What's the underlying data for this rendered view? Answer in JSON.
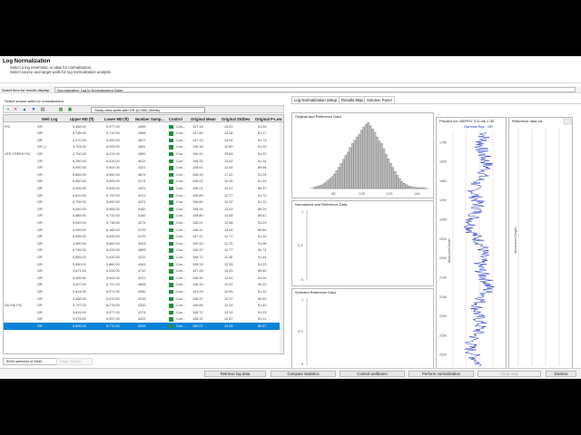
{
  "header": {
    "title": "Log Normalization",
    "line1": "Select a log mnemonic or alias for normalization.",
    "line2": "Select source and target wells for log normalization analysis"
  },
  "results_bar": {
    "label": "Select item for results display:",
    "value": "Normalization Tag to Normalization Base"
  },
  "left": {
    "caption": "Select source wells for normalization",
    "toolbar_icons": [
      "add-icon",
      "remove-icon",
      "up-arrow-icon",
      "down-arrow-icon",
      "filter-icon",
      "grid-icon",
      "zoom-icon"
    ],
    "combo_value": "Study area wells with GR (0,050) (Wells)",
    "columns": [
      "Well Log",
      "Upper MD (ft)",
      "Lower MD (ft)",
      "Number Samp...",
      "Control",
      "Original Mean",
      "Original StdDev",
      "Original P-Low"
    ],
    "rows": [
      {
        "pre": "PIC",
        "log": "GR",
        "upper": "5,358.00",
        "lower": "5,977.00",
        "n": "4969",
        "ctrl": "Con...",
        "mean": "107.18",
        "sd": "13.20",
        "p": "51.33"
      },
      {
        "pre": "",
        "log": "GR",
        "upper": "5,735.50",
        "lower": "5,710.00",
        "n": "4968",
        "ctrl": "Con...",
        "mean": "107.60",
        "sd": "13.36",
        "p": "51.17"
      },
      {
        "pre": "",
        "log": "GR",
        "upper": "2,070.00",
        "lower": "5,400.00",
        "n": "4877",
        "ctrl": "Con...",
        "mean": "107.13",
        "sd": "14.04",
        "p": "51.74"
      },
      {
        "pre": "",
        "log": "GR_1",
        "upper": "3,704.00",
        "lower": "6,005.00",
        "n": "4681",
        "ctrl": "Con...",
        "mean": "108.18",
        "sd": "12.89",
        "p": "51.00"
      },
      {
        "pre": "LES CREEK PIC",
        "log": "GR",
        "upper": "2,700.00",
        "lower": "6,214.00",
        "n": "4882",
        "ctrl": "Con...",
        "mean": "106.41",
        "sd": "13.69",
        "p": "51.22"
      },
      {
        "pre": "",
        "log": "GR",
        "upper": "6,250.00",
        "lower": "6,516.00",
        "n": "4613",
        "ctrl": "Con...",
        "mean": "108.33",
        "sd": "13.62",
        "p": "51.14"
      },
      {
        "pre": "",
        "log": "GR",
        "upper": "5,900.50",
        "lower": "5,904.00",
        "n": "4321",
        "ctrl": "Con...",
        "mean": "108.61",
        "sd": "12.64",
        "p": "89.66"
      },
      {
        "pre": "",
        "log": "GR",
        "upper": "5,855.00",
        "lower": "5,960.00",
        "n": "4874",
        "ctrl": "Con...",
        "mean": "108.16",
        "sd": "17.62",
        "p": "51.24"
      },
      {
        "pre": "",
        "log": "GR",
        "upper": "5,650.50",
        "lower": "5,505.00",
        "n": "4174",
        "ctrl": "Con...",
        "mean": "108.02",
        "sd": "12.05",
        "p": "51.24"
      },
      {
        "pre": "",
        "log": "GR",
        "upper": "5,305.50",
        "lower": "5,506.00",
        "n": "4321",
        "ctrl": "Con...",
        "mean": "108.21",
        "sd": "12.21",
        "p": "89.37"
      },
      {
        "pre": "",
        "log": "GR",
        "upper": "5,810.00",
        "lower": "5,700.00",
        "n": "4221",
        "ctrl": "Con...",
        "mean": "108.89",
        "sd": "12.77",
        "p": "51.72"
      },
      {
        "pre": "",
        "log": "GR",
        "upper": "5,705.00",
        "lower": "5,950.00",
        "n": "4221",
        "ctrl": "Con...",
        "mean": "108.60",
        "sd": "12.92",
        "p": "51.12"
      },
      {
        "pre": "",
        "log": "GR",
        "upper": "5,540.00",
        "lower": "5,965.00",
        "n": "4182",
        "ctrl": "Con...",
        "mean": "108.16",
        "sd": "13.03",
        "p": "89.29"
      },
      {
        "pre": "",
        "log": "GR",
        "upper": "5,885.50",
        "lower": "5,710.00",
        "n": "4150",
        "ctrl": "Con...",
        "mean": "108.80",
        "sd": "13.85",
        "p": "89.61"
      },
      {
        "pre": "",
        "log": "GR",
        "upper": "5,540.00",
        "lower": "5,716.00",
        "n": "4274",
        "ctrl": "Con...",
        "mean": "108.21",
        "sd": "12.88",
        "p": "51.23"
      },
      {
        "pre": "",
        "log": "GR",
        "upper": "4,099.00",
        "lower": "6,186.00",
        "n": "4176",
        "ctrl": "Con...",
        "mean": "108.11",
        "sd": "13.44",
        "p": "89.60"
      },
      {
        "pre": "",
        "log": "GR",
        "upper": "5,595.00",
        "lower": "5,605.00",
        "n": "4176",
        "ctrl": "Con...",
        "mean": "107.11",
        "sd": "12.71",
        "p": "51.16"
      },
      {
        "pre": "",
        "log": "GR",
        "upper": "3,950.50",
        "lower": "5,669.00",
        "n": "4003",
        "ctrl": "Con...",
        "mean": "109.33",
        "sd": "11.73",
        "p": "91.06"
      },
      {
        "pre": "",
        "log": "GR",
        "upper": "5,745.00",
        "lower": "6,026.00",
        "n": "4883",
        "ctrl": "Con...",
        "mean": "105.37",
        "sd": "12.77",
        "p": "90.74"
      },
      {
        "pre": "",
        "log": "GR",
        "upper": "5,855.00",
        "lower": "5,920.00",
        "n": "4211",
        "ctrl": "Con...",
        "mean": "108.71",
        "sd": "11.46",
        "p": "91.44"
      },
      {
        "pre": "",
        "log": "GR",
        "upper": "5,550.00",
        "lower": "5,860.00",
        "n": "4061",
        "ctrl": "Con...",
        "mean": "108.33",
        "sd": "12.39",
        "p": "51.23"
      },
      {
        "pre": "",
        "log": "GR",
        "upper": "3,671.50",
        "lower": "6,026.00",
        "n": "4710",
        "ctrl": "Con...",
        "mean": "107.28",
        "sd": "13.20",
        "p": "89.60"
      },
      {
        "pre": "",
        "log": "GR",
        "upper": "5,305.50",
        "lower": "5,904.00",
        "n": "4221",
        "ctrl": "Con...",
        "mean": "108.90",
        "sd": "12.61",
        "p": "51.00"
      },
      {
        "pre": "",
        "log": "GR",
        "upper": "3,007.50",
        "lower": "5,721.00",
        "n": "4898",
        "ctrl": "Con...",
        "mean": "108.10",
        "sd": "12.32",
        "p": "90.22"
      },
      {
        "pre": "",
        "log": "GR",
        "upper": "3,514.00",
        "lower": "5,971.00",
        "n": "4050",
        "ctrl": "Con...",
        "mean": "103.99",
        "sd": "12.99",
        "p": "51.22"
      },
      {
        "pre": "",
        "log": "GR",
        "upper": "3,466.50",
        "lower": "5,570.00",
        "n": "4215",
        "ctrl": "Con...",
        "mean": "108.37",
        "sd": "12.37",
        "p": "89.60"
      },
      {
        "pre": "DU FAI PIC",
        "log": "GR",
        "upper": "3,797.00",
        "lower": "6,279.00",
        "n": "4320",
        "ctrl": "Con...",
        "mean": "108.66",
        "sd": "12.24",
        "p": "51.42"
      },
      {
        "pre": "",
        "log": "GR",
        "upper": "3,815.00",
        "lower": "5,977.00",
        "n": "4174",
        "ctrl": "Con...",
        "mean": "108.70",
        "sd": "13.10",
        "p": "91.23"
      },
      {
        "pre": "",
        "log": "GR",
        "upper": "3,975.50",
        "lower": "6,037.00",
        "n": "4222",
        "ctrl": "Con...",
        "mean": "108.10",
        "sd": "12.87",
        "p": "51.11"
      },
      {
        "pre": "",
        "log": "GR",
        "upper": "5,606.00",
        "lower": "5,770.00",
        "n": "4206",
        "ctrl": "Con...",
        "mean": "109.07",
        "sd": "13.26",
        "p": "89.57"
      }
    ],
    "selected_index": 29,
    "status": "5940 selected of 5940",
    "page_box": "Page (Wells)"
  },
  "tabs": [
    "Log Normalization Setup",
    "Results Map",
    "Solution Panel"
  ],
  "active_tab": 2,
  "panels": {
    "histogram_title": "Original and Reference Data",
    "normalized_title": "Normalized and Reference Data",
    "selected_title": "Selected Reference Data",
    "preview_title": "Preview for: MDPHY 3 G-rnk 2-30",
    "reference_title": "Reference data for:",
    "track_label": "Gamma Ray - GR",
    "y_axis_label": "Measured Depth"
  },
  "chart_data": [
    {
      "type": "bar",
      "title": "Original and Reference Data",
      "x_ticks": [
        80,
        100,
        120,
        140
      ],
      "xlim": [
        62,
        148
      ],
      "ylim": [
        0,
        100
      ],
      "values": [
        2,
        3,
        4,
        5,
        7,
        9,
        12,
        15,
        18,
        22,
        27,
        32,
        38,
        44,
        50,
        55,
        62,
        68,
        73,
        78,
        82,
        88,
        93,
        97,
        100,
        95,
        90,
        85,
        78,
        72,
        68,
        60,
        52,
        45,
        38,
        32,
        26,
        20,
        15,
        11,
        8,
        6,
        4,
        3,
        2,
        2,
        1,
        1,
        1,
        1
      ]
    },
    {
      "type": "line",
      "title": "Preview for: MDPHY 3 G-rnk 2-30",
      "xlabel": "Gamma Ray - GR",
      "ylabel": "Measured Depth",
      "y_ticks": [
        1750,
        1800,
        1850,
        1900,
        1950,
        2000,
        2050,
        2100,
        2150,
        2200,
        2250,
        2300
      ],
      "ylim": [
        1720,
        2330
      ],
      "xlim": [
        0,
        200
      ]
    }
  ],
  "buttons": {
    "retrieve": "Retrieve log data",
    "compute": "Compute statistics",
    "control": "Control wellbores",
    "perform": "Perform normalization",
    "clear": "Clear map",
    "dismiss": "Dismiss"
  },
  "colors": {
    "selection": "#0b83d6",
    "control_swatch": "#1f8f3f",
    "histogram_bar": "#bfbfbf",
    "curve": "#1a33cc"
  }
}
